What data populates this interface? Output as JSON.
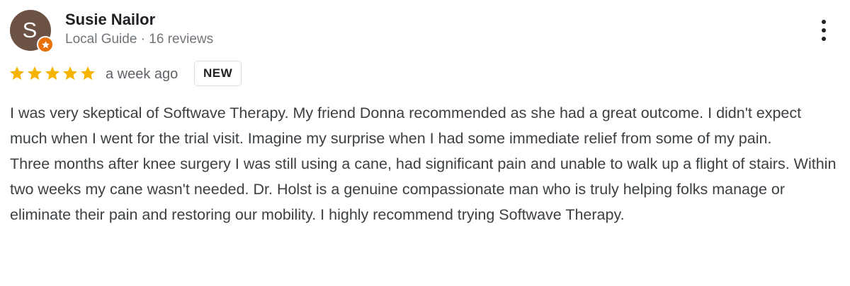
{
  "review": {
    "author": {
      "initial": "S",
      "name": "Susie Nailor",
      "meta": "Local Guide · 16 reviews",
      "avatar_color": "#6b5244",
      "badge_color": "#e8710a",
      "badge_icon": "star-icon"
    },
    "rating": 5,
    "rating_max": 5,
    "star_color": "#f4b400",
    "time_ago": "a week ago",
    "badge": "NEW",
    "more_icon": "more-vertical-icon",
    "paragraphs": [
      "I was very skeptical of Softwave Therapy. My friend Donna recommended as she had a great outcome. I didn't expect much when I went for the trial visit. Imagine my surprise when I had some immediate relief from some of my pain.",
      "Three months after knee surgery I was still using a cane, had significant pain and unable to walk up a flight of stairs. Within two weeks my cane wasn't needed. Dr. Holst is a genuine compassionate man who is truly helping folks manage or eliminate their pain and restoring our mobility. I highly recommend trying Softwave Therapy."
    ]
  }
}
